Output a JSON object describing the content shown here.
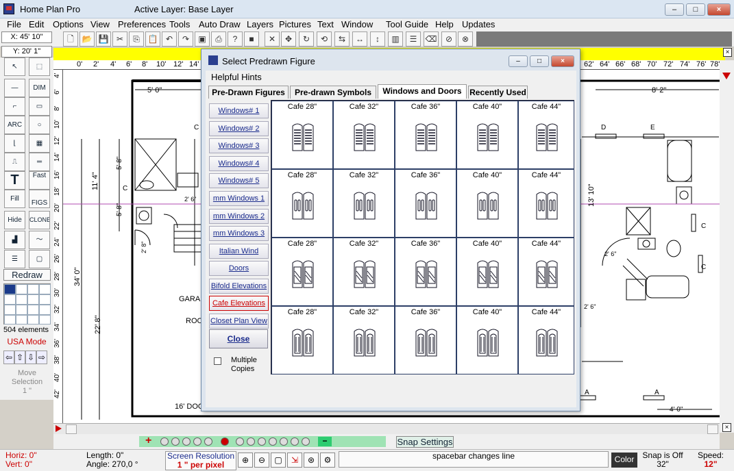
{
  "app": {
    "title": "Home Plan Pro",
    "active_layer": "Active Layer: Base Layer",
    "window_buttons": [
      "–",
      "□",
      "×"
    ]
  },
  "menu": [
    "File",
    "Edit",
    "Options",
    "View",
    "Preferences",
    "Tools",
    "Auto Draw",
    "Layers",
    "Pictures",
    "Text",
    "Window",
    "Tool Guide",
    "Help",
    "Updates"
  ],
  "coords": {
    "x": "X: 45' 10\"",
    "y": "Y: 20' 1\""
  },
  "ruler_top": [
    "0'",
    "2'",
    "4'",
    "6'",
    "8'",
    "10'",
    "12'",
    "14'",
    "62'",
    "64'",
    "66'",
    "68'",
    "70'",
    "72'",
    "74'",
    "76'",
    "78'"
  ],
  "ruler_left": [
    "4'",
    "6'",
    "8'",
    "10'",
    "12'",
    "14'",
    "16'",
    "18'",
    "20'",
    "22'",
    "24'",
    "26'",
    "28'",
    "30'",
    "32'",
    "34'",
    "36'",
    "38'",
    "40'",
    "42'"
  ],
  "palette": {
    "dim_label": "DIM",
    "arc_label": "ARC",
    "text_label": "T",
    "fast_label": "Fast",
    "fill_label": "Fill",
    "figs_label": "FIGS",
    "hide_label": "Hide",
    "clone_label": "CLONE",
    "redraw": "Redraw",
    "elements": "504 elements",
    "mode": "USA Mode",
    "move_selection": "Move Selection",
    "move_amount": "1 \""
  },
  "plan_labels": {
    "dim_5_0": "5' 0\"",
    "dim_8_2": "8' 2\"",
    "dim_11_4": "11' 4\"",
    "dim_5_8a": "5' 8\"",
    "dim_5_8b": "5' 8\"",
    "dim_34_0": "34' 0\"",
    "dim_22_8": "22' 8\"",
    "dim_13_10": "13' 10\"",
    "dim_4_0": "4' 0\"",
    "dim_2_8": "2' 8\"",
    "dim_2_6a": "2' 6\"",
    "dim_2_6b": "2' 6\"",
    "dim_2_6c": "2' 6\"",
    "garage": "GARA",
    "room": "ROO",
    "door": "16' DOO",
    "tag_c": "C",
    "tag_d": "D",
    "tag_e": "E",
    "tag_a": "A"
  },
  "dialog": {
    "title": "Select Predrawn Figure",
    "helpful_hints": "Helpful Hints",
    "tabs": [
      "Pre-Drawn Figures",
      "Pre-drawn Symbols",
      "Windows and Doors",
      "Recently Used"
    ],
    "active_tab": 2,
    "categories": [
      "Windows# 1",
      "Windows# 2",
      "Windows# 3",
      "Windows# 4",
      "Windows# 5",
      "mm Windows 1",
      "mm Windows 2",
      "mm Windows 3",
      "Italian Wind",
      "Doors",
      "Bifold Elevations",
      "Cafe Elevations",
      "Closet Plan View"
    ],
    "active_category": 11,
    "close": "Close",
    "multiple_copies": "Multiple Copies",
    "figure_rows": [
      [
        "Cafe 28\"",
        "Cafe 32\"",
        "Cafe 36\"",
        "Cafe 40\"",
        "Cafe 44\""
      ],
      [
        "Cafe 28\"",
        "Cafe 32\"",
        "Cafe 36\"",
        "Cafe 40\"",
        "Cafe 44\""
      ],
      [
        "Cafe 28\"",
        "Cafe 32\"",
        "Cafe 36\"",
        "Cafe 40\"",
        "Cafe 44\""
      ],
      [
        "Cafe 28\"",
        "Cafe 32\"",
        "Cafe 36\"",
        "Cafe 40\"",
        "Cafe 44\""
      ]
    ]
  },
  "snap_settings": "Snap Settings",
  "status": {
    "horiz": "Horiz: 0\"",
    "vert": "Vert:  0\"",
    "length": "Length:  0\"",
    "angle": "Angle:  270,0 °",
    "screen_res_label": "Screen Resolution",
    "screen_res_value": "1 \" per pixel",
    "hint": "spacebar changes line",
    "color": "Color",
    "snap_label": "Snap is Off",
    "snap_value": "32\"",
    "speed_label": "Speed:",
    "speed_value": "12\""
  },
  "colors": {
    "accent_red": "#cc0000",
    "yellow_bar": "#ffff00",
    "layer_green": "#9fe3b4"
  }
}
